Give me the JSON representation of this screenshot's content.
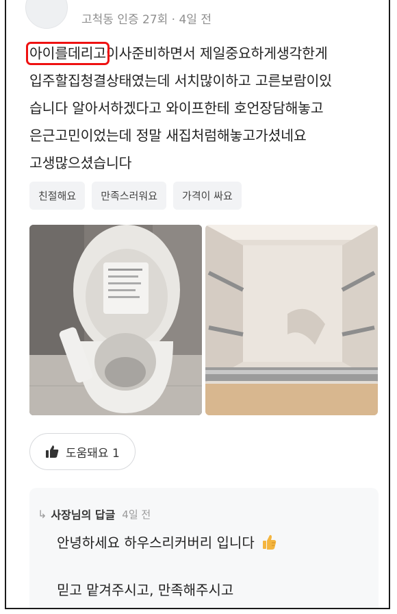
{
  "review": {
    "meta": "고척동 인증 27회 · 4일 전",
    "highlight": "아이를데리고",
    "line1_rest": "이사준비하면서 제일중요하게생각한게",
    "line2": "입주할집청결상태였는데 서치많이하고 고른보람이있",
    "line3": "습니다 알아서하겠다고 와이프한테 호언장담해놓고",
    "line4": "은근고민이었는데 정말 새집처럼해놓고가셨네요",
    "line5": "고생많으셨습니다"
  },
  "tags": [
    "친절해요",
    "만족스러워요",
    "가격이 싸요"
  ],
  "helpful": {
    "label": "도움돼요 1"
  },
  "reply": {
    "owner_label": "사장님의 답글",
    "date": "4일 전",
    "line1": "안녕하세요 하우스리커버리 입니다",
    "line2": "믿고 맡겨주시고, 만족해주시고"
  },
  "icons": {
    "thumbs_up": "thumbs-up-icon",
    "reply_arrow": "reply-arrow-icon",
    "thumbs_emoji": "thumbs-up-emoji"
  },
  "colors": {
    "highlight_box": "#e11111",
    "tag_bg": "#f2f3f5",
    "reply_bg": "#f7f8f9",
    "emoji": "#f4b53f"
  }
}
